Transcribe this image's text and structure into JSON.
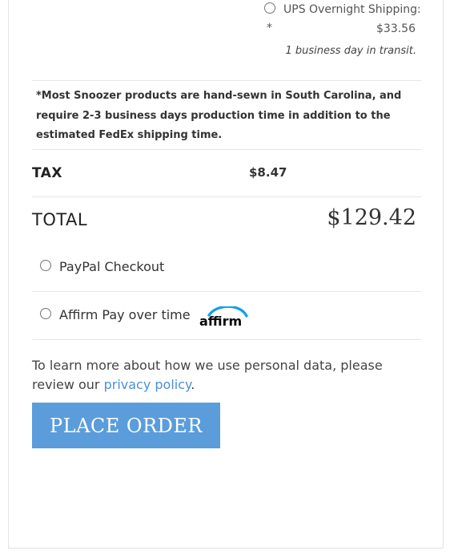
{
  "shipping": {
    "option_label": "UPS Overnight Shipping:",
    "option_marker": "*",
    "option_price": "$33.56",
    "transit": "1 business day in transit."
  },
  "note": "*Most Snoozer products are hand-sewn in South Carolina, and require 2-3 business days production time in addition to the estimated FedEx shipping time.",
  "tax": {
    "label": "TAX",
    "value": "$8.47"
  },
  "total": {
    "label": "TOTAL",
    "value": "$129.42"
  },
  "payment_methods": [
    {
      "label": "PayPal Checkout"
    },
    {
      "label": "Affirm Pay over time",
      "logo_text": "affirm"
    }
  ],
  "privacy": {
    "text_before": "To learn more about how we use personal data, please review our ",
    "link_text": "privacy policy",
    "text_after": "."
  },
  "place_order_label": "PLACE ORDER",
  "colors": {
    "accent": "#5b9ddb",
    "link": "#4a90d9",
    "affirm_blue": "#0fa0ea",
    "affirm_text": "#060809"
  }
}
